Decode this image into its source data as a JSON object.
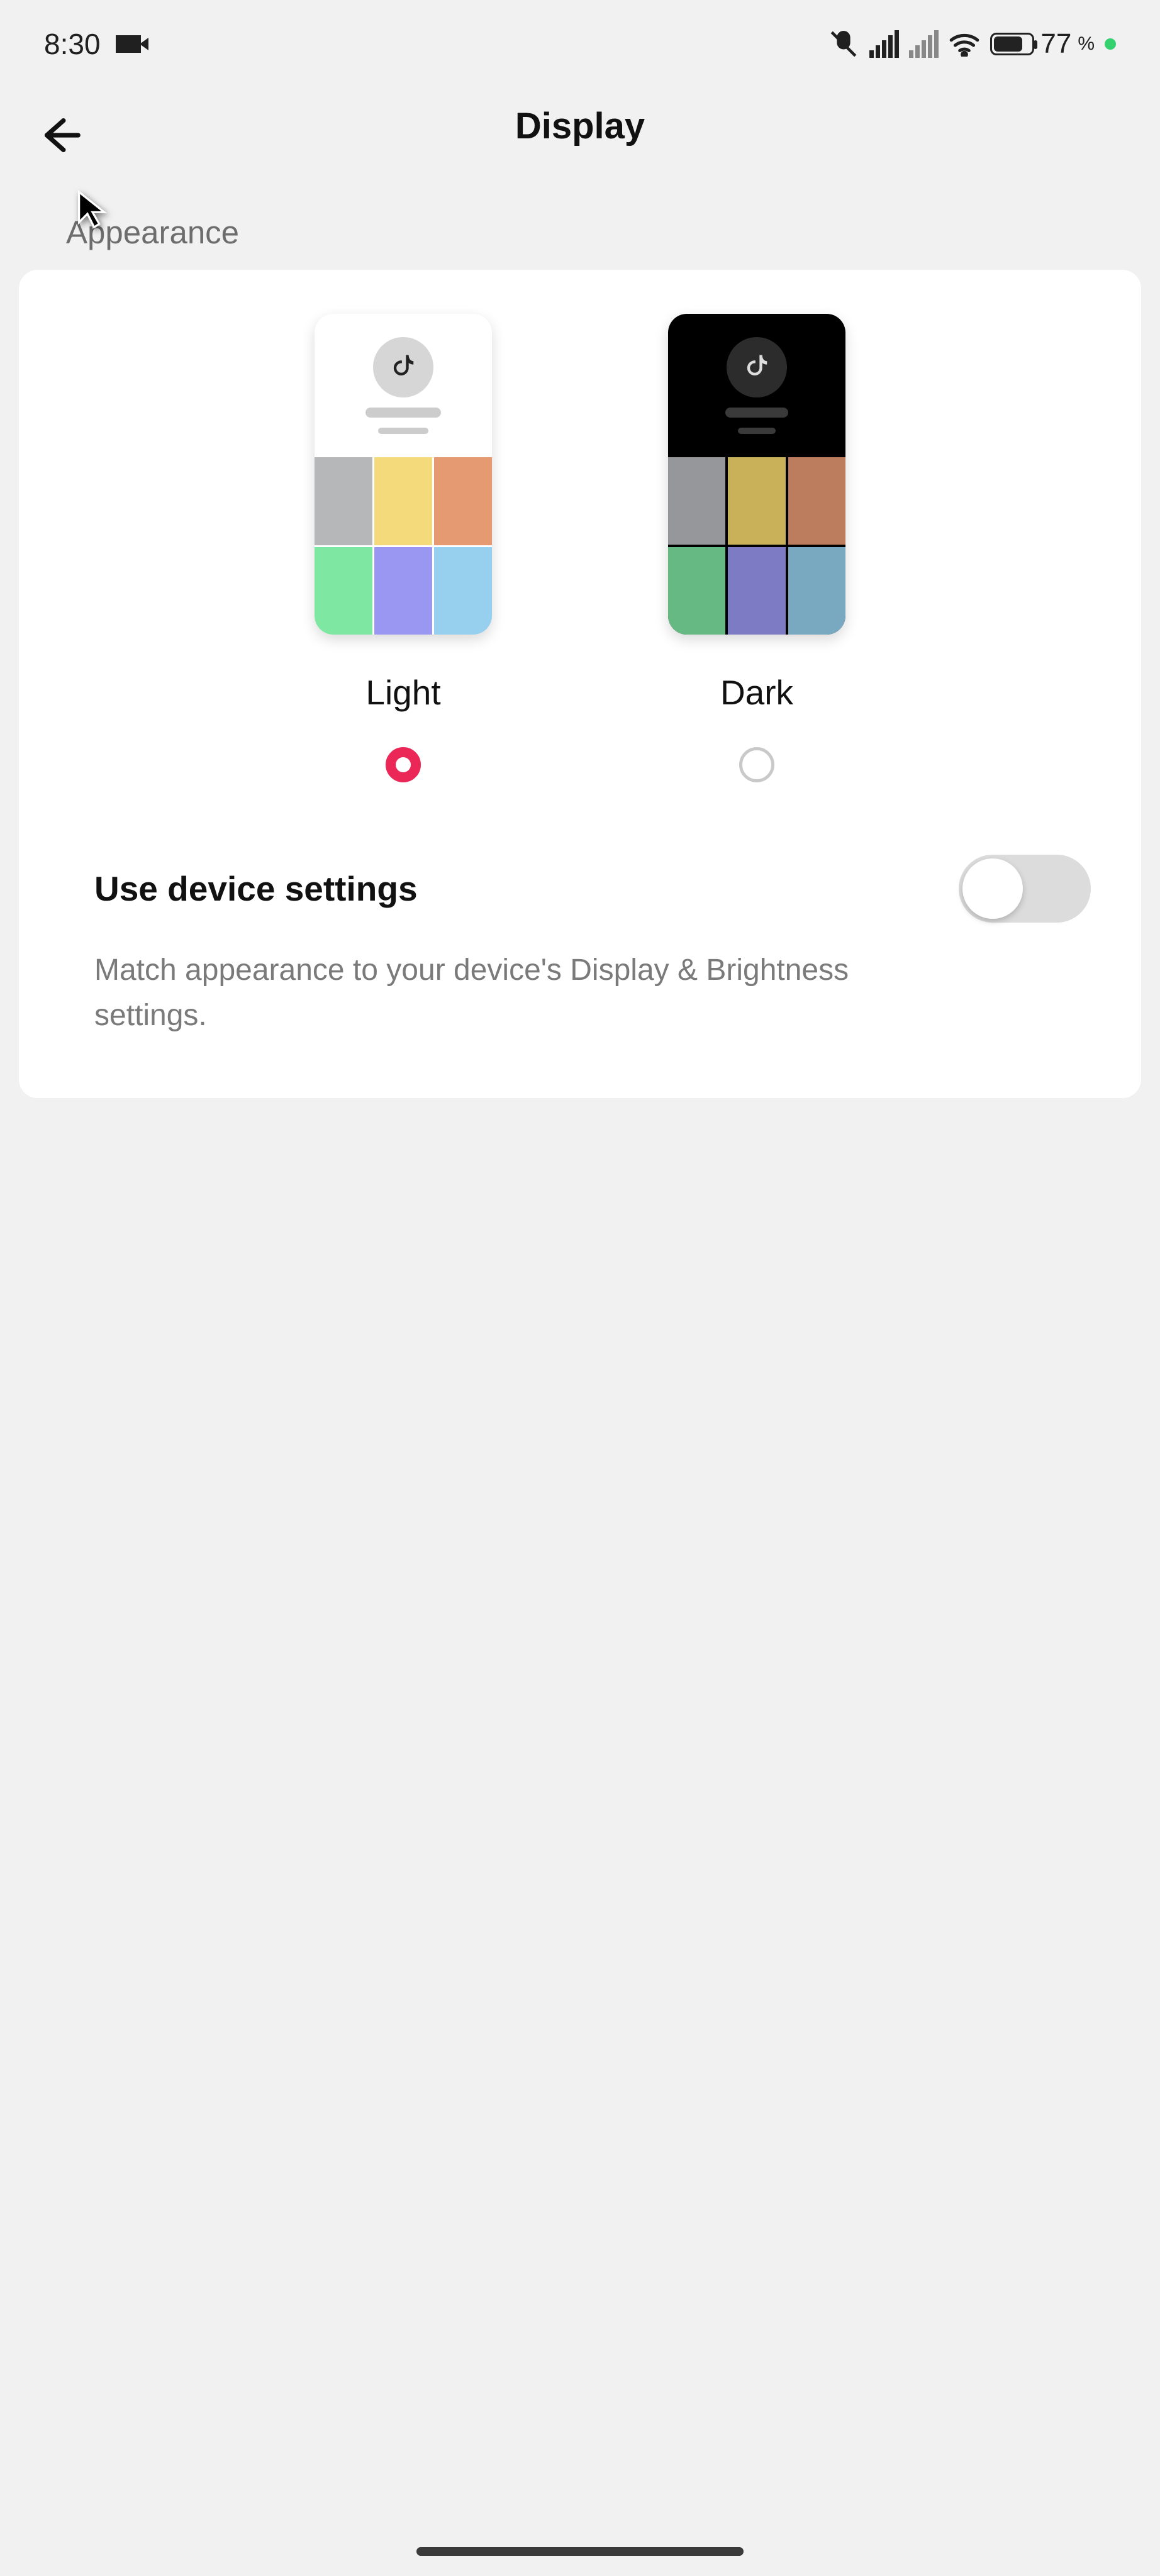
{
  "status": {
    "time": "8:30",
    "battery_percent": "77",
    "battery_suffix": "%"
  },
  "header": {
    "title": "Display"
  },
  "section": {
    "label": "Appearance"
  },
  "appearance": {
    "options": {
      "light": {
        "label": "Light",
        "selected": true
      },
      "dark": {
        "label": "Dark",
        "selected": false
      }
    },
    "use_device": {
      "title": "Use device settings",
      "description": "Match appearance to your device's Display & Brightness settings.",
      "enabled": false
    }
  }
}
